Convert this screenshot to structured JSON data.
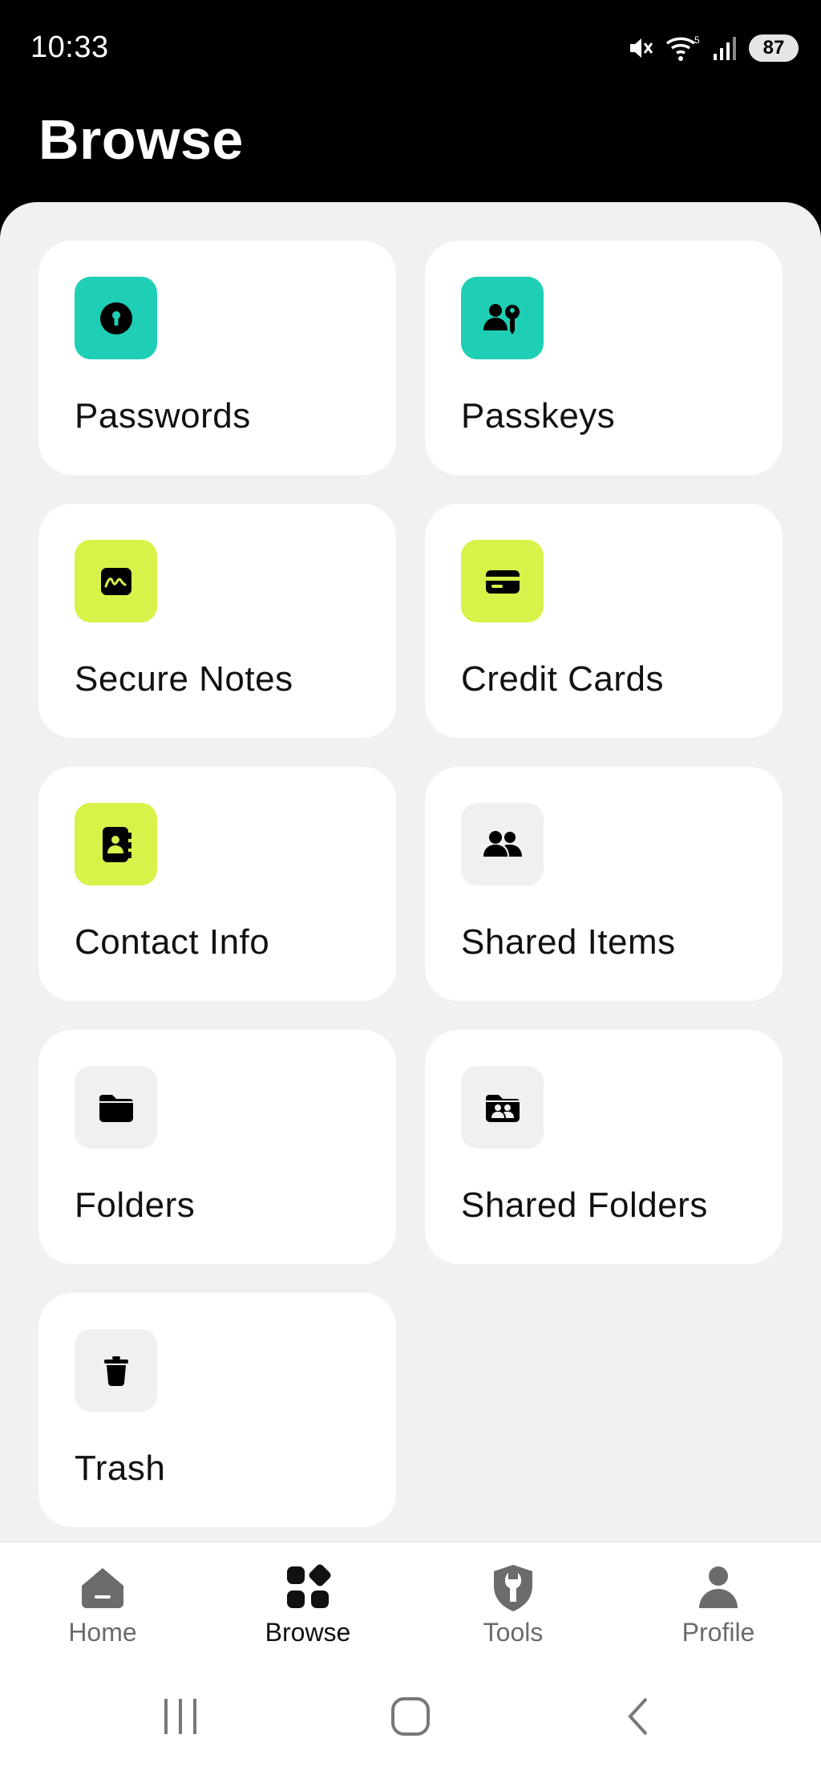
{
  "status_bar": {
    "time": "10:33",
    "battery": "87"
  },
  "header": {
    "title": "Browse"
  },
  "categories": [
    {
      "label": "Passwords",
      "icon": "keyhole-icon",
      "tile": "teal"
    },
    {
      "label": "Passkeys",
      "icon": "passkey-icon",
      "tile": "teal"
    },
    {
      "label": "Secure Notes",
      "icon": "signature-note-icon",
      "tile": "lime"
    },
    {
      "label": "Credit Cards",
      "icon": "credit-card-icon",
      "tile": "lime"
    },
    {
      "label": "Contact Info",
      "icon": "contact-book-icon",
      "tile": "lime"
    },
    {
      "label": "Shared Items",
      "icon": "people-icon",
      "tile": "gray"
    },
    {
      "label": "Folders",
      "icon": "folder-icon",
      "tile": "gray"
    },
    {
      "label": "Shared Folders",
      "icon": "shared-folder-icon",
      "tile": "gray"
    },
    {
      "label": "Trash",
      "icon": "trash-icon",
      "tile": "gray"
    }
  ],
  "bottom_nav": {
    "active": "Browse",
    "items": [
      {
        "label": "Home",
        "icon": "home-icon"
      },
      {
        "label": "Browse",
        "icon": "browse-grid-icon"
      },
      {
        "label": "Tools",
        "icon": "tools-shield-icon"
      },
      {
        "label": "Profile",
        "icon": "profile-icon"
      }
    ]
  },
  "colors": {
    "teal": "#1fcfb5",
    "lime": "#d9f24a",
    "tile_gray": "#f1f0ee",
    "sheet_bg": "#f1f1f1"
  }
}
